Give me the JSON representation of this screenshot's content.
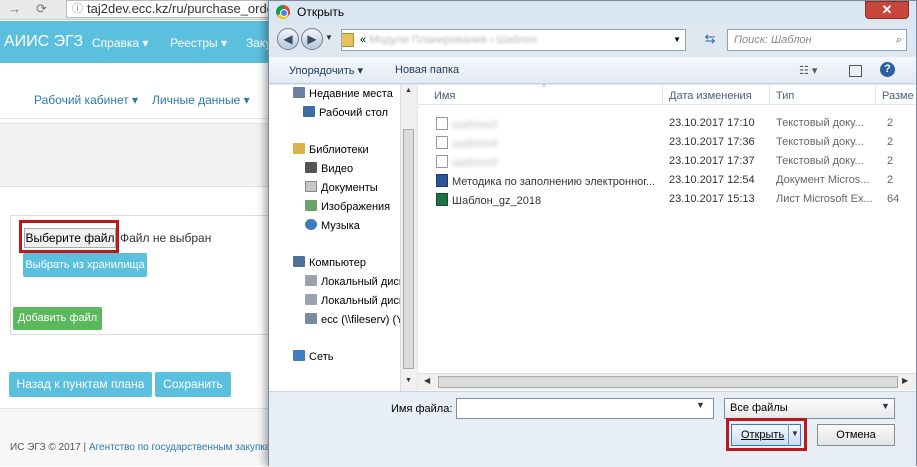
{
  "browser": {
    "url": "taj2dev.ecc.kz/ru/purchase_orde"
  },
  "site": {
    "brand": "АИИС ЭГЗ",
    "topnav": [
      "Справка ▾",
      "Реестры ▾",
      "Заку"
    ],
    "subnav": [
      "Рабочий кабинет ▾",
      "Личные данные ▾"
    ],
    "upload": {
      "choose_file": "Выберите файл",
      "no_file": "Файл не выбран",
      "storage": "Выбрать из хранилища",
      "add_file": "Добавить файл"
    },
    "back_button": "Назад к пунктам плана",
    "save_button": "Сохранить",
    "footer_copy": "ИС ЭГЗ © 2017 | ",
    "footer_link": "Агентство по государственным закупкам"
  },
  "dialog": {
    "title": "Открыть",
    "close": "✕",
    "breadcrumb_prefix": "«",
    "breadcrumb_blurred": "Модули Планирования  ›  Шаблон",
    "search_placeholder": "Поиск: Шаблон",
    "toolbar": {
      "organize": "Упорядочить ▾",
      "new_folder": "Новая папка"
    },
    "tree": [
      {
        "label": "Недавние места",
        "icon": "recent-places-icon"
      },
      {
        "label": "Рабочий стол",
        "icon": "desktop-icon"
      },
      {
        "label": "Библиотеки",
        "icon": "libraries-icon"
      },
      {
        "label": "Видео",
        "icon": "video-icon"
      },
      {
        "label": "Документы",
        "icon": "documents-icon"
      },
      {
        "label": "Изображения",
        "icon": "images-icon"
      },
      {
        "label": "Музыка",
        "icon": "music-icon"
      },
      {
        "label": "Компьютер",
        "icon": "computer-icon"
      },
      {
        "label": "Локальный диск",
        "icon": "disk-icon"
      },
      {
        "label": "Локальный диск",
        "icon": "disk-icon"
      },
      {
        "label": "ecc (\\\\fileserv) (Y",
        "icon": "network-drive-icon"
      },
      {
        "label": "Сеть",
        "icon": "network-icon"
      }
    ],
    "columns": [
      "Имя",
      "Дата изменения",
      "Тип",
      "Разме"
    ],
    "files": [
      {
        "name": "шаблон3",
        "date": "23.10.2017 17:10",
        "type": "Текстовый доку...",
        "size": "2",
        "kind": "txt",
        "blur": true
      },
      {
        "name": "шаблон4",
        "date": "23.10.2017 17:36",
        "type": "Текстовый доку...",
        "size": "2",
        "kind": "txt",
        "blur": true
      },
      {
        "name": "шаблон5",
        "date": "23.10.2017 17:37",
        "type": "Текстовый доку...",
        "size": "2",
        "kind": "txt",
        "blur": true
      },
      {
        "name": "Методика по заполнению электронног...",
        "date": "23.10.2017 12:54",
        "type": "Документ Micros...",
        "size": "2",
        "kind": "doc",
        "blur": false
      },
      {
        "name": "Шаблон_gz_2018",
        "date": "23.10.2017 15:13",
        "type": "Лист Microsoft Ex...",
        "size": "64",
        "kind": "xls",
        "blur": false
      }
    ],
    "filename_label": "Имя файла:",
    "filename_value": "",
    "filter": "Все файлы",
    "open": "Открыть",
    "cancel": "Отмена"
  }
}
